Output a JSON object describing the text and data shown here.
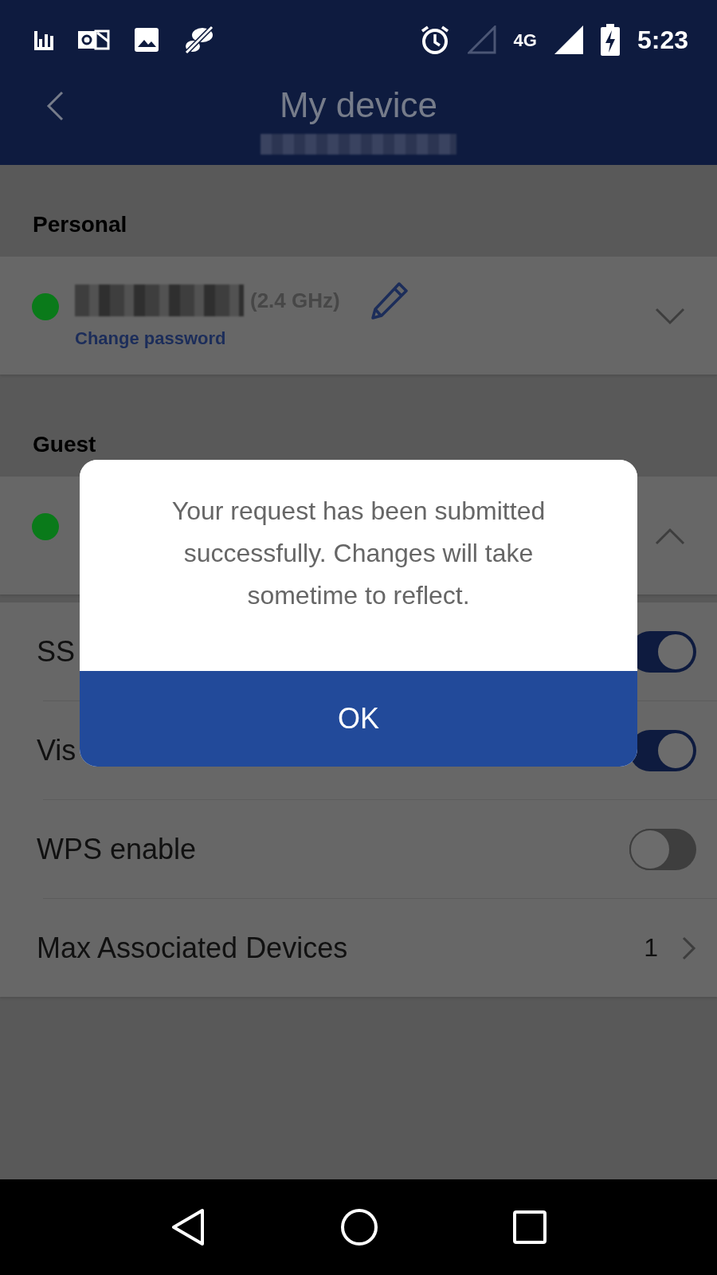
{
  "status_bar": {
    "network": "4G",
    "time": "5:23"
  },
  "header": {
    "title": "My device"
  },
  "sections": [
    {
      "title": "Personal",
      "network": {
        "color": "#0a7a1a",
        "band": "(2.4 GHz)",
        "link": "Change password",
        "expanded": false
      }
    },
    {
      "title": "Guest",
      "network": {
        "color": "#0a7a1a",
        "expanded": true
      }
    }
  ],
  "settings": [
    {
      "kind": "toggle",
      "label": "SS",
      "on": true
    },
    {
      "kind": "toggle",
      "label": "Vis",
      "on": true
    },
    {
      "kind": "toggle",
      "label": "WPS enable",
      "on": false
    },
    {
      "kind": "value",
      "label": "Max Associated Devices",
      "value": "1"
    }
  ],
  "dialog": {
    "message": "Your request has been submitted successfully. Changes will take sometime to reflect.",
    "button": "OK"
  }
}
